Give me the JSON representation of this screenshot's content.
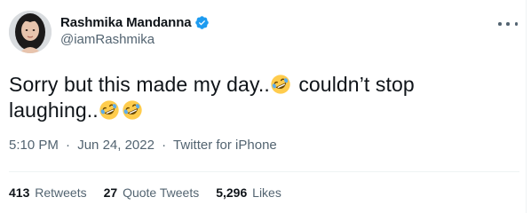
{
  "author": {
    "display_name": "Rashmika Mandanna",
    "handle": "@iamRashmika",
    "verified": true,
    "avatar_icon": "profile-photo"
  },
  "tweet": {
    "text_part1": "Sorry but this made my day..",
    "text_part2": " couldn’t stop laughing..",
    "emoji_name": "rolling-on-the-floor-laughing"
  },
  "meta": {
    "time": "5:10 PM",
    "date": "Jun 24, 2022",
    "source": "Twitter for iPhone",
    "separator": "·"
  },
  "stats": {
    "retweets_count": "413",
    "retweets_label": "Retweets",
    "quotes_count": "27",
    "quotes_label": "Quote Tweets",
    "likes_count": "5,296",
    "likes_label": "Likes"
  },
  "colors": {
    "primary_text": "#0f1419",
    "secondary_text": "#536471",
    "verified_blue": "#1d9bf0",
    "divider": "#eff3f4"
  }
}
